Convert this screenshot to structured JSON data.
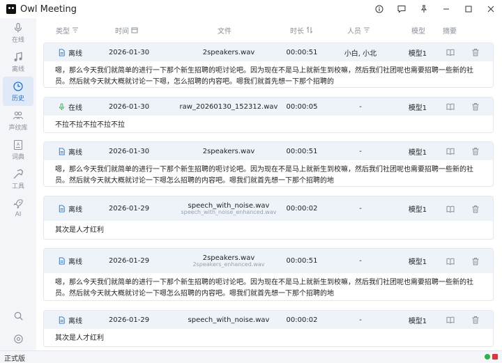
{
  "app": {
    "title": "Owl Meeting"
  },
  "window": {
    "controls": [
      "info-icon",
      "chat-icon",
      "pin-icon",
      "minimize-icon",
      "maximize-icon",
      "close-icon"
    ]
  },
  "sidebar": {
    "items": [
      {
        "label": "在线",
        "icon": "mic-icon"
      },
      {
        "label": "离线",
        "icon": "music-icon"
      },
      {
        "label": "历史",
        "icon": "history-icon",
        "active": true
      },
      {
        "label": "声纹库",
        "icon": "users-icon"
      },
      {
        "label": "词典",
        "icon": "dictionary-icon"
      },
      {
        "label": "工具",
        "icon": "tools-icon"
      },
      {
        "label": "AI",
        "icon": "rocket-icon"
      }
    ],
    "bottom": [
      "search-icon",
      "settings-icon"
    ]
  },
  "table": {
    "headers": {
      "type": "类型",
      "time": "时间",
      "file": "文件",
      "duration": "时长",
      "people": "人员",
      "model": "模型",
      "summary": "摘要"
    },
    "rows": [
      {
        "type": "离线",
        "type_icon": "file-icon",
        "date": "2026-01-30",
        "file": "2speakers.wav",
        "file_sub": "",
        "duration": "00:00:51",
        "people": "小白, 小北",
        "model": "模型1",
        "text": "嗯，那么今天我们就简单的进行一下那个新生招聘的呃讨论吧。因为现在不是马上就新生到校嘛，然后我们社团呢也需要招聘一些新的社员。然后就今天就大概就讨论一下嗯，怎么招聘的内容吧。嗯我们就首先想一下那个招聘的"
      },
      {
        "type": "在线",
        "type_icon": "mic-icon",
        "date": "2026-01-30",
        "file": "raw_20260130_152312.wav",
        "file_sub": "",
        "duration": "00:00:05",
        "people": "-",
        "model": "模型1",
        "text": "不拉不拉不拉不拉不拉"
      },
      {
        "type": "离线",
        "type_icon": "file-icon",
        "date": "2026-01-30",
        "file": "2speakers.wav",
        "file_sub": "",
        "duration": "00:00:51",
        "people": "-",
        "model": "模型1",
        "text": "嗯，那么今天我们就简单的进行一下那个新生招聘的呃讨论吧。因为现在不是马上就新生到校嘛，然后我们社团呢也需要招聘一些新的社员。然后就今天就大概就讨论一下嗯怎么招聘的内容吧。嗯我们就首先想一下那个招聘的地"
      },
      {
        "type": "离线",
        "type_icon": "file-icon",
        "date": "2026-01-29",
        "file": "speech_with_noise.wav",
        "file_sub": "speech_with_noise_enhanced.wav",
        "duration": "00:00:02",
        "people": "-",
        "model": "模型1",
        "text": "其次是人才红利"
      },
      {
        "type": "离线",
        "type_icon": "file-icon",
        "date": "2026-01-29",
        "file": "2speakers.wav",
        "file_sub": "2speakers_enhanced.wav",
        "duration": "00:00:51",
        "people": "-",
        "model": "模型1",
        "text": "嗯，那么今天我们就简单的进行一下那个新生招聘的呃讨论吧。因为现在不是马上就新生到校嘛，然后我们社团呢也需要招聘一些新的社员。然后就今天就大概就讨论一下嗯怎么招聘的内容吧。嗯我们就首先想一下那个招聘的地"
      },
      {
        "type": "离线",
        "type_icon": "file-icon",
        "date": "2026-01-29",
        "file": "speech_with_noise.wav",
        "file_sub": "",
        "duration": "00:00:02",
        "people": "-",
        "model": "模型1",
        "text": "其次是人才红利"
      }
    ]
  },
  "statusbar": {
    "edition": "正式版"
  },
  "colors": {
    "accent": "#1f6fd6",
    "row_header_bg": "#eef3fa",
    "online_icon": "#2fb344",
    "offline_icon": "#1f6fd6"
  }
}
